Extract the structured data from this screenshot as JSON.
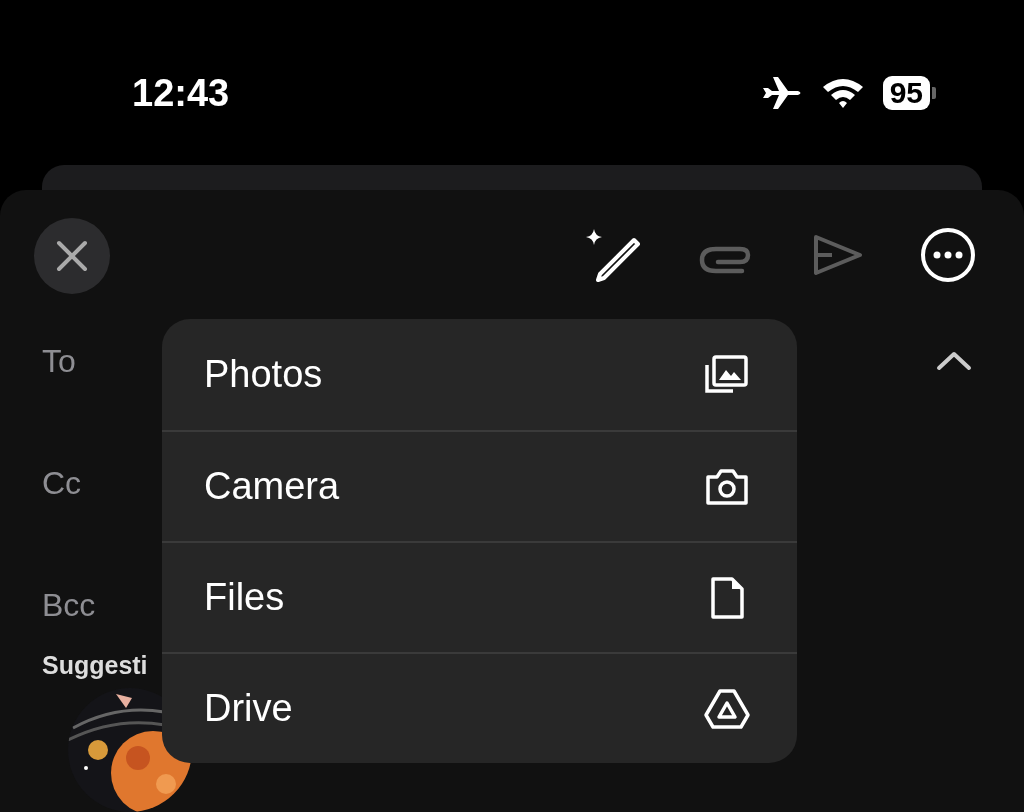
{
  "status_bar": {
    "time": "12:43",
    "airplane_mode": true,
    "battery": "95"
  },
  "toolbar": [
    {
      "kind": "ai-write",
      "disabled": false
    },
    {
      "kind": "attach",
      "disabled": true
    },
    {
      "kind": "send",
      "disabled": true
    },
    {
      "kind": "more",
      "disabled": false
    }
  ],
  "fields": [
    {
      "label": "To",
      "expanded": true
    },
    {
      "label": "Cc"
    },
    {
      "label": "Bcc"
    }
  ],
  "suggestions": {
    "heading": "Suggesti"
  },
  "attach_menu": [
    {
      "label": "Photos",
      "kind": "photos"
    },
    {
      "label": "Camera",
      "kind": "camera"
    },
    {
      "label": "Files",
      "kind": "file"
    },
    {
      "label": "Drive",
      "kind": "drive"
    }
  ]
}
